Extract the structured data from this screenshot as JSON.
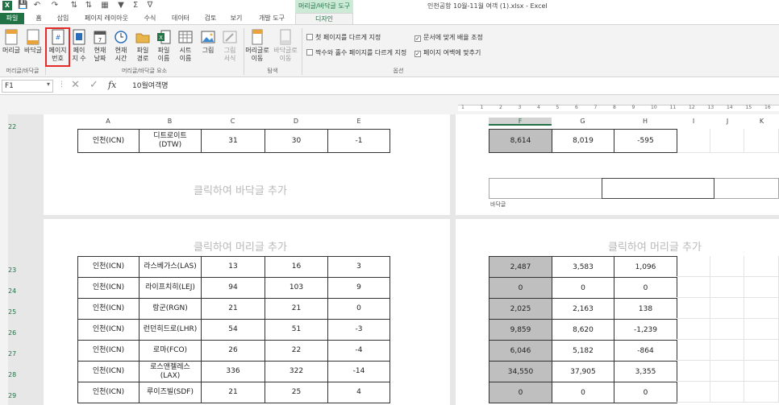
{
  "window": {
    "title": "인천공항 10월-11월 여객 (1).xlsx - Excel",
    "context_group": "머리글/바닥글 도구",
    "qa_icons": [
      "excel-logo-icon",
      "save-icon",
      "undo-icon",
      "redo-icon",
      "sort-asc-icon",
      "sort-desc-icon",
      "table-icon",
      "filter-icon",
      "sum-icon",
      "more-icon"
    ]
  },
  "tabs": [
    {
      "label": "파일"
    },
    {
      "label": "홈"
    },
    {
      "label": "삽입"
    },
    {
      "label": "페이지 레이아웃"
    },
    {
      "label": "수식"
    },
    {
      "label": "데이터"
    },
    {
      "label": "검토"
    },
    {
      "label": "보기"
    },
    {
      "label": "개발 도구"
    },
    {
      "label": "디자인"
    }
  ],
  "ribbon": {
    "header_footer": {
      "header": "머리글",
      "footer": "바닥글",
      "group": "머리글/바닥글"
    },
    "elements": {
      "page_number": "페이지\n번호",
      "page_count": "페이\n지 수",
      "current_date": "현재\n날짜",
      "current_time": "현재\n시간",
      "file_path": "파일\n경로",
      "file_name": "파일\n이름",
      "sheet_name": "시트\n이름",
      "picture": "그림",
      "format_picture": "그림\n서식",
      "group": "머리글/바닥글 요소"
    },
    "navigation": {
      "go_header": "머리글로\n이동",
      "go_footer": "바닥글로\n이동",
      "group": "탐색"
    },
    "options": {
      "different_first": "첫 페이지를 다르게 지정",
      "different_odd_even": "짝수와 홀수 페이지를 다르게 지정",
      "scale_with_doc": "문서에 맞게 배율 조정",
      "align_margins": "페이지 여백에 맞추기",
      "different_first_checked": false,
      "different_odd_even_checked": false,
      "scale_with_doc_checked": true,
      "align_margins_checked": true,
      "group": "옵션"
    }
  },
  "formula_bar": {
    "name_box": "F1",
    "fx": "fx",
    "formula": "10월여객명"
  },
  "sheet": {
    "col_headers_left": [
      "A",
      "B",
      "C",
      "D",
      "E"
    ],
    "col_headers_right": [
      "F",
      "G",
      "H",
      "I",
      "J",
      "K"
    ],
    "footer_placeholder": "클릭하여 바닥글 추가",
    "header_placeholder": "클릭하여 머리글 추가",
    "footer_label": "바닥글",
    "ruler_ticks": [
      "1",
      "1",
      "2",
      "3",
      "4",
      "5",
      "6",
      "7",
      "8",
      "9",
      "10",
      "11",
      "12",
      "13",
      "14",
      "15",
      "16"
    ],
    "row22": {
      "num": "22",
      "a": "인천(ICN)",
      "b": "디트로이트\n(DTW)",
      "c": "31",
      "d": "30",
      "e": "-1",
      "f": "8,614",
      "g": "8,019",
      "h": "-595"
    },
    "rows": [
      {
        "num": "23",
        "a": "인천(ICN)",
        "b": "라스베가스(LAS)",
        "c": "13",
        "d": "16",
        "e": "3",
        "f": "2,487",
        "g": "3,583",
        "h": "1,096"
      },
      {
        "num": "24",
        "a": "인천(ICN)",
        "b": "라이프치히(LEJ)",
        "c": "94",
        "d": "103",
        "e": "9",
        "f": "0",
        "g": "0",
        "h": "0"
      },
      {
        "num": "25",
        "a": "인천(ICN)",
        "b": "랑군(RGN)",
        "c": "21",
        "d": "21",
        "e": "0",
        "f": "2,025",
        "g": "2,163",
        "h": "138"
      },
      {
        "num": "26",
        "a": "인천(ICN)",
        "b": "런던히드로(LHR)",
        "c": "54",
        "d": "51",
        "e": "-3",
        "f": "9,859",
        "g": "8,620",
        "h": "-1,239"
      },
      {
        "num": "27",
        "a": "인천(ICN)",
        "b": "로마(FCO)",
        "c": "26",
        "d": "22",
        "e": "-4",
        "f": "6,046",
        "g": "5,182",
        "h": "-864"
      },
      {
        "num": "28",
        "a": "인천(ICN)",
        "b": "로스앤젤레스\n(LAX)",
        "c": "336",
        "d": "322",
        "e": "-14",
        "f": "34,550",
        "g": "37,905",
        "h": "3,355"
      },
      {
        "num": "29",
        "a": "인천(ICN)",
        "b": "루이즈빌(SDF)",
        "c": "21",
        "d": "25",
        "e": "4",
        "f": "0",
        "g": "0",
        "h": "0"
      }
    ]
  }
}
